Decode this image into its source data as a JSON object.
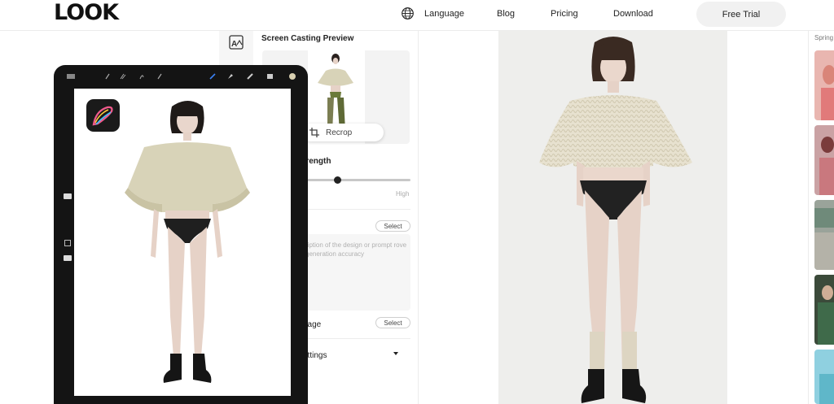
{
  "header": {
    "logo": "LOOK",
    "nav": [
      {
        "label": "Language"
      },
      {
        "label": "Blog"
      },
      {
        "label": "Pricing"
      },
      {
        "label": "Download"
      }
    ],
    "free_trial": "Free Trial"
  },
  "panel": {
    "title": "Screen Casting Preview",
    "recrop": "Recrop",
    "strength_label": "trength",
    "strength_high": "High",
    "strength_value": 0.33,
    "prompt_select": "Select",
    "prompt_placeholder": "ription of the design or prompt rove generation accuracy",
    "image_label": "nage",
    "image_select": "Select",
    "settings_label": "ettings"
  },
  "gallery": {
    "label": "Spring"
  },
  "colors": {
    "accent": "#1fc65a",
    "sweater": "#d8d3b8",
    "knit": "#e8e3d3",
    "brief": "#222222",
    "hair": "#3a2a22",
    "skin": "#e6d2c7"
  }
}
